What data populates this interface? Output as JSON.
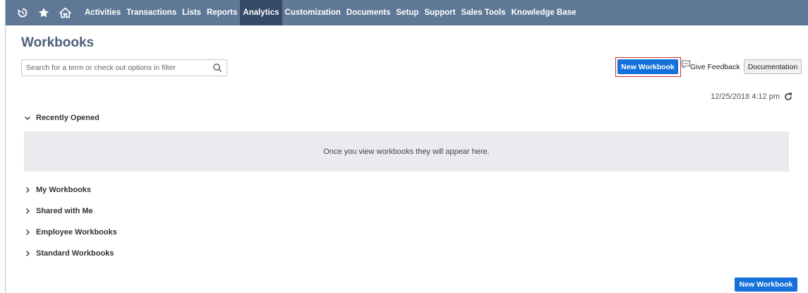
{
  "nav": {
    "icons": [
      "recent-icon",
      "star-icon",
      "home-icon"
    ],
    "items": [
      {
        "label": "Activities",
        "active": false
      },
      {
        "label": "Transactions",
        "active": false
      },
      {
        "label": "Lists",
        "active": false
      },
      {
        "label": "Reports",
        "active": false
      },
      {
        "label": "Analytics",
        "active": true
      },
      {
        "label": "Customization",
        "active": false
      },
      {
        "label": "Documents",
        "active": false
      },
      {
        "label": "Setup",
        "active": false
      },
      {
        "label": "Support",
        "active": false
      },
      {
        "label": "Sales Tools",
        "active": false
      },
      {
        "label": "Knowledge Base",
        "active": false
      }
    ]
  },
  "page": {
    "title": "Workbooks",
    "search_placeholder": "Search for a term or check out options in filter",
    "search_value": ""
  },
  "actions": {
    "new_workbook": "New Workbook",
    "give_feedback": "Give Feedback",
    "documentation": "Documentation"
  },
  "timestamp": "12/25/2018 4:12 pm",
  "sections": {
    "recently_opened": {
      "label": "Recently Opened",
      "expanded": true,
      "empty_message": "Once you view workbooks they will appear here."
    },
    "my_workbooks": {
      "label": "My Workbooks",
      "expanded": false
    },
    "shared_with_me": {
      "label": "Shared with Me",
      "expanded": false
    },
    "employee_workbooks": {
      "label": "Employee Workbooks",
      "expanded": false
    },
    "standard_workbooks": {
      "label": "Standard Workbooks",
      "expanded": false
    }
  },
  "colors": {
    "nav_bg": "#5f7896",
    "nav_active": "#344a66",
    "primary": "#1571da",
    "title": "#4d5f79",
    "highlight": "#d52b2b"
  }
}
